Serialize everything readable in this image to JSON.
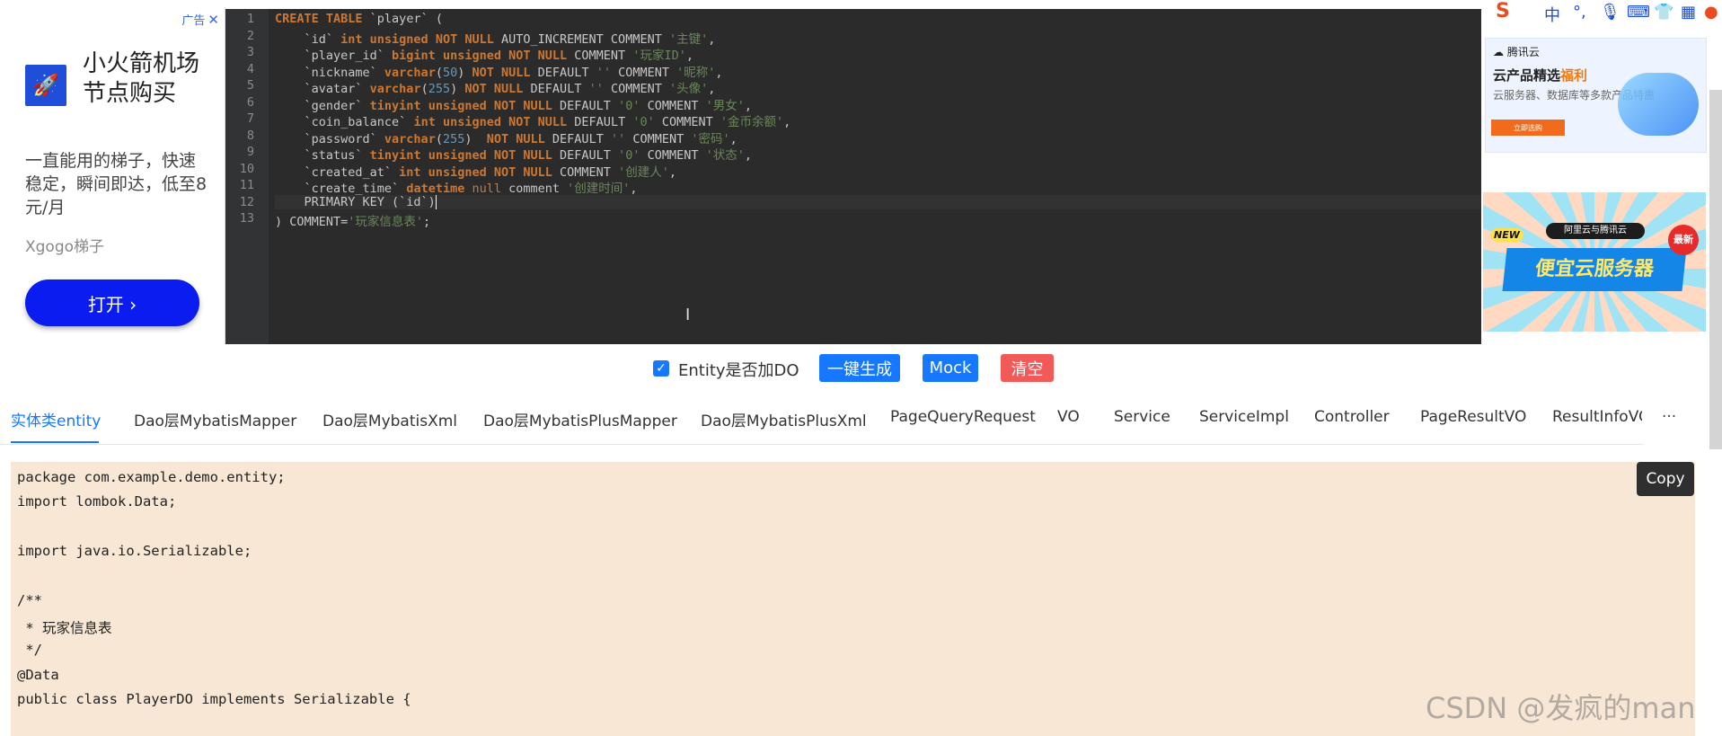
{
  "left_ad": {
    "tag": "广告",
    "close": "✕",
    "title": "小火箭机场节点购买",
    "desc": "一直能用的梯子，快速稳定，瞬间即达，低至8元/月",
    "brand": "Xgogo梯子",
    "button": "打开 ›"
  },
  "editor": {
    "line_numbers": [
      "1",
      "2",
      "3",
      "4",
      "5",
      "6",
      "7",
      "8",
      "9",
      "10",
      "11",
      "12",
      "13"
    ]
  },
  "toolbar_right": {
    "icons": [
      "sogou-logo-icon",
      "zhong-char-icon",
      "punctuation-icon",
      "mic-icon",
      "keyboard-icon",
      "shirt-icon",
      "grid-icon",
      "avatar-icon"
    ],
    "ime_char": "中"
  },
  "tencent_ad": {
    "brand": "腾讯云",
    "title_prefix": "云产品精选",
    "title_highlight": "福利",
    "subtitle": "云服务器、数据库等多款产品特惠",
    "button": "立即选购"
  },
  "cheap_ad": {
    "new": "NEW",
    "tag": "阿里云与腾讯云",
    "main": "便宜云服务器",
    "latest": "最新"
  },
  "controls": {
    "checkbox_label": "Entity是否加DO",
    "generate": "一键生成",
    "mock": "Mock",
    "clear": "清空"
  },
  "tabs": [
    "实体类entity",
    "Dao层MybatisMapper",
    "Dao层MybatisXml",
    "Dao层MybatisPlusMapper",
    "Dao层MybatisPlusXml",
    "PageQueryRequest",
    "VO",
    "Service",
    "ServiceImpl",
    "Controller",
    "PageResultVO",
    "ResultInfoVO"
  ],
  "tab_more": "···",
  "output": {
    "copy": "Copy",
    "lines": [
      "package com.example.demo.entity;",
      "import lombok.Data;",
      "",
      "import java.io.Serializable;",
      "",
      "/**",
      " * 玩家信息表",
      " */",
      "@Data",
      "public class PlayerDO implements Serializable {"
    ]
  },
  "watermark": "CSDN @发疯的man",
  "colors": {
    "accent": "#1677ff",
    "danger": "#f25a5a",
    "editor_bg": "#2b2b2b",
    "output_bg": "#f8e7d4"
  }
}
